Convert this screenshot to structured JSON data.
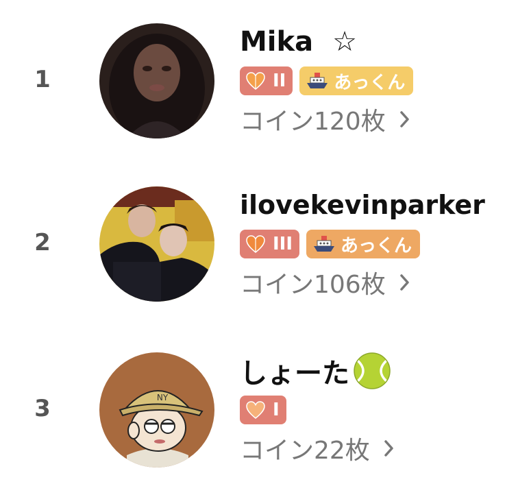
{
  "ranking": [
    {
      "rank": "1",
      "name": "Mika",
      "name_suffix": "☆",
      "level_badge": {
        "icon": "heart-icon",
        "label": "II"
      },
      "team_badge": {
        "icon": "ship-icon",
        "label": "あっくん"
      },
      "coins": "コイン120枚",
      "avatar": "avatar-photo"
    },
    {
      "rank": "2",
      "name": "ilovekevinparker",
      "level_badge": {
        "icon": "heart-icon",
        "label": "III"
      },
      "team_badge": {
        "icon": "ship-icon",
        "label": "あっくん"
      },
      "coins": "コイン106枚",
      "avatar": "avatar-photo"
    },
    {
      "rank": "3",
      "name": "しょーた",
      "name_suffix_icon": "tennis-ball-icon",
      "level_badge": {
        "icon": "heart-icon",
        "label": "I"
      },
      "coins": "コイン22枚",
      "avatar": "avatar-cartoon"
    }
  ],
  "colors": {
    "level_badge": "#e07f73",
    "team_badge_rank1": "#f5cc69",
    "team_badge_rank2": "#eea863",
    "coin_text": "#777777",
    "rank_text": "#555555"
  }
}
